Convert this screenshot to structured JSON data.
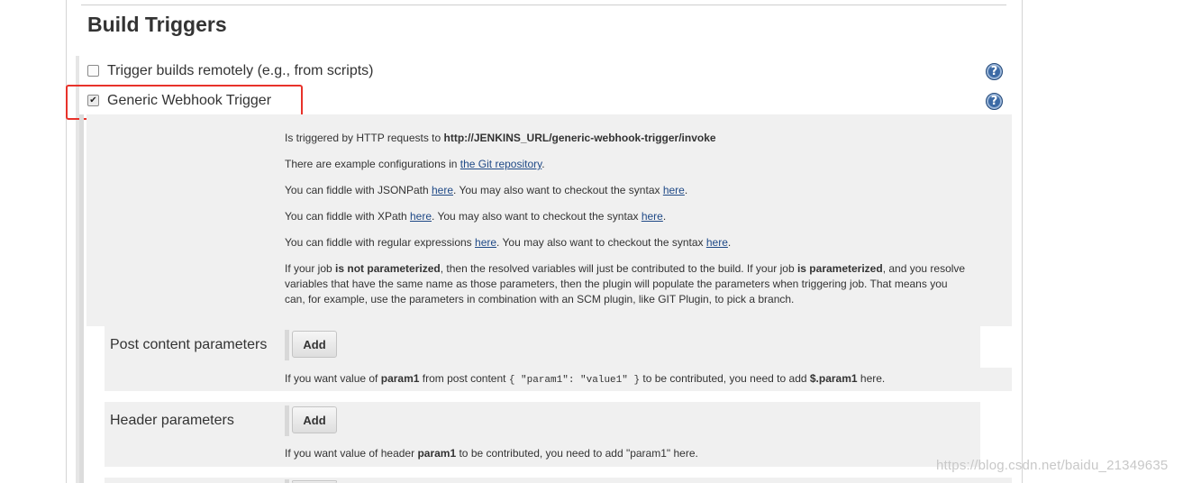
{
  "section": {
    "title": "Build Triggers"
  },
  "triggers": [
    {
      "label": "Trigger builds remotely (e.g., from scripts)",
      "checked": false
    },
    {
      "label": "Generic Webhook Trigger",
      "checked": true
    }
  ],
  "help_icon_glyph": "?",
  "description": {
    "p1_prefix": "Is triggered by HTTP requests to ",
    "p1_url": "http://JENKINS_URL/generic-webhook-trigger/invoke",
    "p2_prefix": "There are example configurations in ",
    "p2_link": "the Git repository",
    "p2_suffix": ".",
    "p3_prefix": "You can fiddle with JSONPath ",
    "p3_link1": "here",
    "p3_mid": ". You may also want to checkout the syntax ",
    "p3_link2": "here",
    "p3_suffix": ".",
    "p4_prefix": "You can fiddle with XPath ",
    "p4_link1": "here",
    "p4_mid": ". You may also want to checkout the syntax ",
    "p4_link2": "here",
    "p4_suffix": ".",
    "p5_prefix": "You can fiddle with regular expressions ",
    "p5_link1": "here",
    "p5_mid": ". You may also want to checkout the syntax ",
    "p5_link2": "here",
    "p5_suffix": ".",
    "p6_a": "If your job ",
    "p6_b": "is not parameterized",
    "p6_c": ", then the resolved variables will just be contributed to the build. If your job ",
    "p6_d": "is parameterized",
    "p6_e": ", and you resolve variables that have the same name as those parameters, then the plugin will populate the parameters when triggering job. That means you can, for example, use the parameters in combination with an SCM plugin, like GIT Plugin, to pick a branch."
  },
  "post_content": {
    "label": "Post content parameters",
    "add_label": "Add",
    "hint_a": "If you want value of ",
    "hint_b": "param1",
    "hint_c": " from post content ",
    "hint_code": "{ \"param1\": \"value1\" }",
    "hint_d": " to be contributed, you need to add ",
    "hint_e": "$.param1",
    "hint_f": " here."
  },
  "header_params": {
    "label": "Header parameters",
    "add_label": "Add",
    "hint_a": "If you want value of header ",
    "hint_b": "param1",
    "hint_c": " to be contributed, you need to add \"param1\" here."
  },
  "watermark": "https://blog.csdn.net/baidu_21349635",
  "colors": {
    "highlight": "#e8322a",
    "link": "#204a87",
    "panel": "#f0f0f0"
  }
}
